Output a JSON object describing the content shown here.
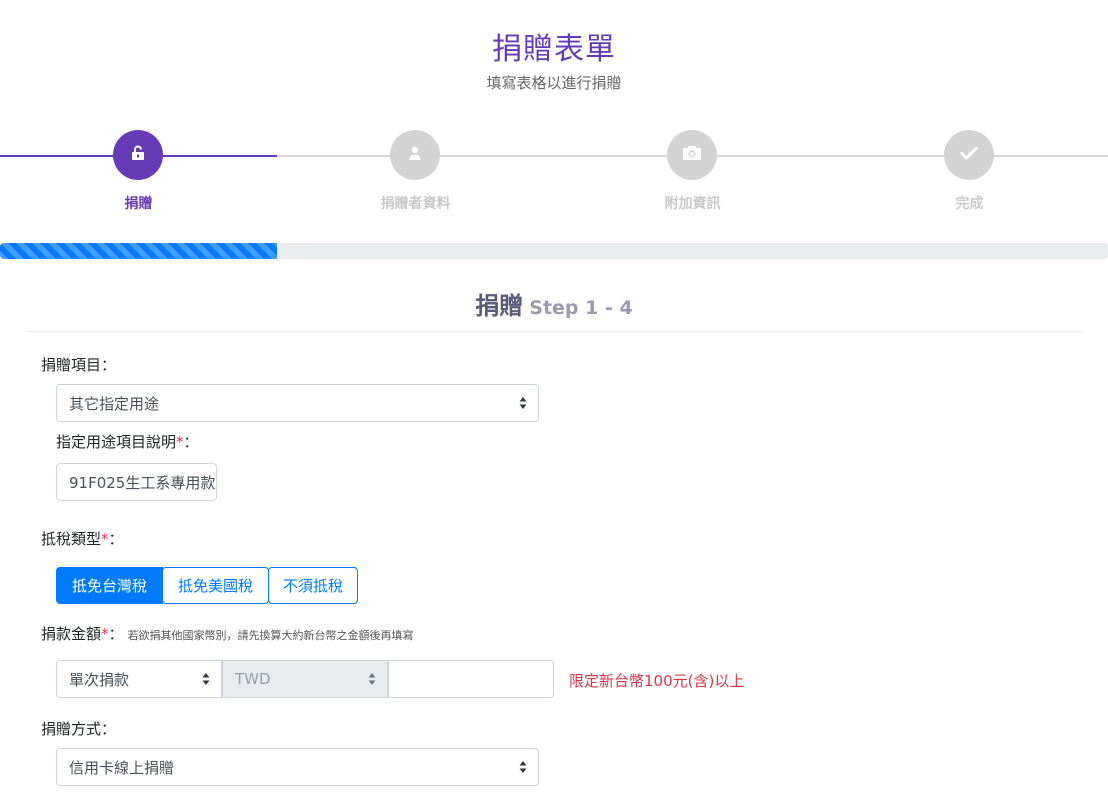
{
  "header": {
    "title": "捐贈表單",
    "subtitle": "填寫表格以進行捐贈"
  },
  "steps": [
    {
      "label": "捐贈",
      "icon": "unlock-icon",
      "active": true
    },
    {
      "label": "捐贈者資料",
      "icon": "user-icon",
      "active": false
    },
    {
      "label": "附加資訊",
      "icon": "camera-icon",
      "active": false
    },
    {
      "label": "完成",
      "icon": "check-icon",
      "active": false
    }
  ],
  "progress": 0.25,
  "section": {
    "title": "捐贈",
    "step": "Step 1 - 4"
  },
  "form": {
    "item_label": "捐贈項目：",
    "item_value": "其它指定用途",
    "purpose_label": "指定用途項目說明",
    "purpose_value": "91F025生工系專用款",
    "tax_label": "抵稅類型",
    "tax_options": [
      "抵免台灣稅",
      "抵免美國稅",
      "不須抵稅"
    ],
    "tax_selected": "抵免台灣稅",
    "amount_label": "捐款金額",
    "amount_hint": "若欲捐其他國家幣別，請先換算大約新台幣之金額後再填寫",
    "frequency_value": "單次捐款",
    "currency_value": "TWD",
    "amount_value": "",
    "amount_limit": "限定新台幣100元(含)以上",
    "method_label": "捐贈方式：",
    "method_value": "信用卡線上捐贈",
    "colon": "："
  },
  "colors": {
    "accent": "#673ab7",
    "primary": "#007bff",
    "danger": "#dc3545"
  }
}
